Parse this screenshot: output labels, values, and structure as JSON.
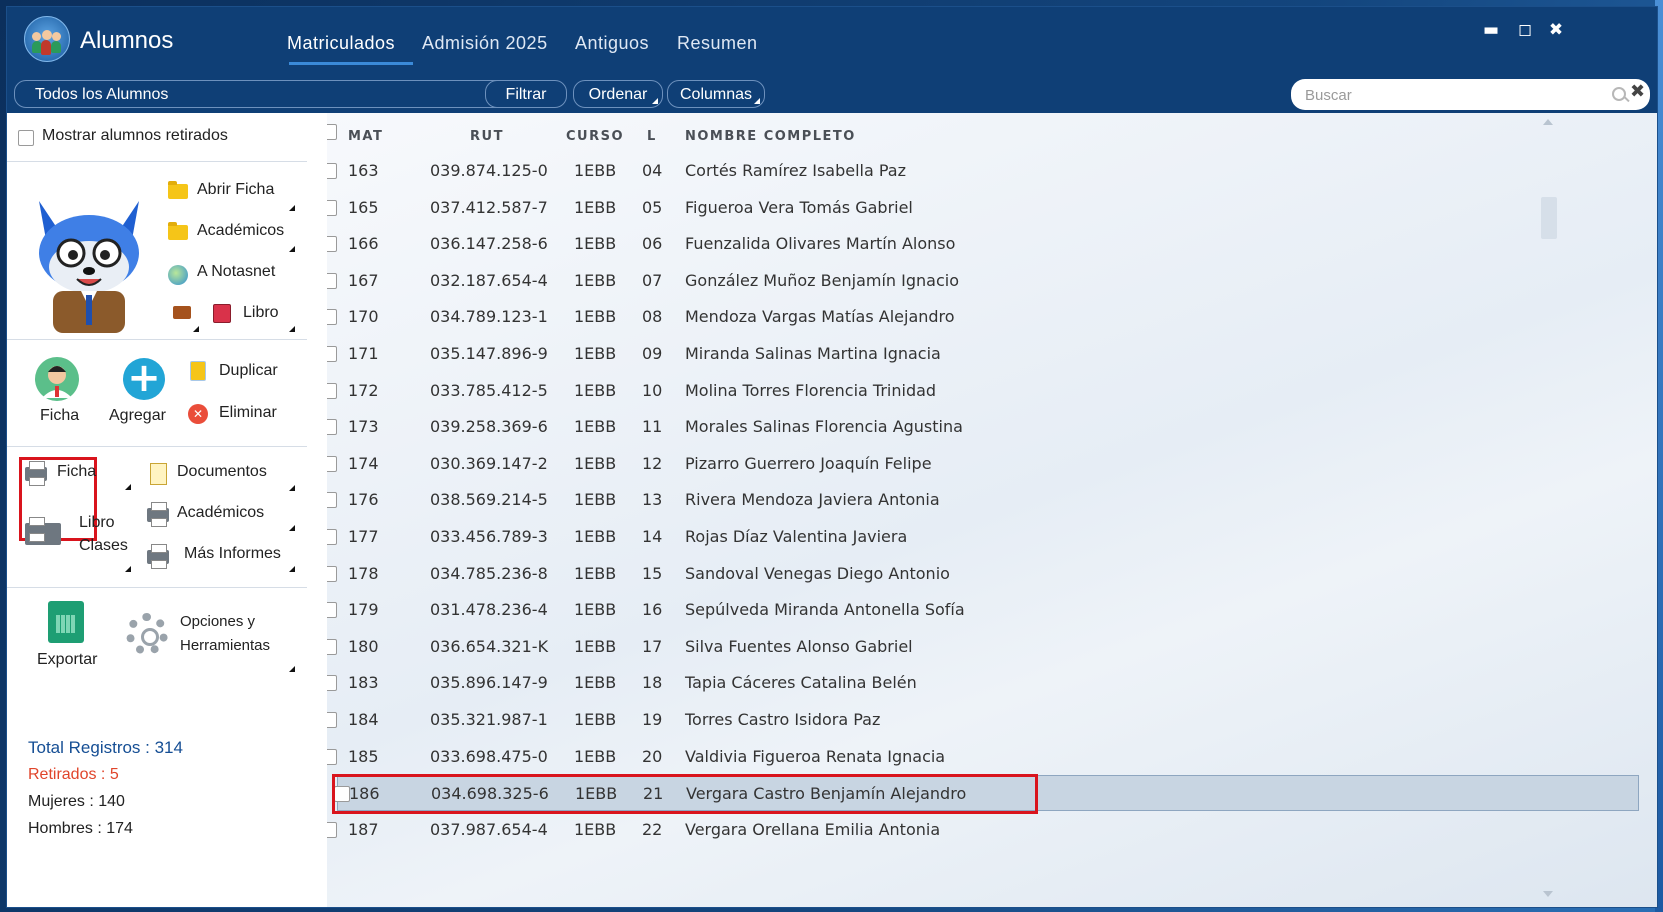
{
  "app": {
    "title": "Alumnos",
    "tabs": [
      "Matriculados",
      "Admisión 2025",
      "Antiguos",
      "Resumen"
    ],
    "active_tab": "Matriculados",
    "window_controls": {
      "minimize": "▬",
      "maximize": "◻",
      "close": "✖"
    }
  },
  "toolbar": {
    "filter_value": "Todos los Alumnos",
    "filter_button": "Filtrar",
    "sort_button": "Ordenar",
    "columns_button": "Columnas",
    "search_placeholder": "Buscar"
  },
  "sidebar": {
    "show_retired_label": "Mostrar alumnos retirados",
    "quick_actions": {
      "open_file": "Abrir Ficha",
      "academics": "Académicos",
      "notasnet": "A Notasnet",
      "book": "Libro"
    },
    "main_actions": {
      "ficha": "Ficha",
      "add": "Agregar",
      "duplicate": "Duplicar",
      "delete": "Eliminar"
    },
    "print": {
      "ficha": "Ficha",
      "documents": "Documentos",
      "academics": "Académicos",
      "class_book_1": "Libro",
      "class_book_2": "Clases",
      "more_reports": "Más Informes"
    },
    "export": "Exportar",
    "options_1": "Opciones y",
    "options_2": "Herramientas",
    "stats": {
      "total": "Total Registros : 314",
      "retired": "Retirados : 5",
      "women": "Mujeres : 140",
      "men": "Hombres : 174"
    }
  },
  "table": {
    "headers": {
      "mat": "MAT",
      "rut": "RUT",
      "curso": "CURSO",
      "l": "L",
      "nombre": "NOMBRE COMPLETO"
    },
    "rows": [
      {
        "mat": "163",
        "rut": "039.874.125-0",
        "curso": "1EBB",
        "l": "04",
        "nombre": "Cortés Ramírez Isabella Paz"
      },
      {
        "mat": "165",
        "rut": "037.412.587-7",
        "curso": "1EBB",
        "l": "05",
        "nombre": "Figueroa Vera Tomás Gabriel"
      },
      {
        "mat": "166",
        "rut": "036.147.258-6",
        "curso": "1EBB",
        "l": "06",
        "nombre": "Fuenzalida Olivares Martín Alonso"
      },
      {
        "mat": "167",
        "rut": "032.187.654-4",
        "curso": "1EBB",
        "l": "07",
        "nombre": "González Muñoz Benjamín Ignacio"
      },
      {
        "mat": "170",
        "rut": "034.789.123-1",
        "curso": "1EBB",
        "l": "08",
        "nombre": "Mendoza Vargas Matías Alejandro"
      },
      {
        "mat": "171",
        "rut": "035.147.896-9",
        "curso": "1EBB",
        "l": "09",
        "nombre": "Miranda Salinas Martina Ignacia"
      },
      {
        "mat": "172",
        "rut": "033.785.412-5",
        "curso": "1EBB",
        "l": "10",
        "nombre": "Molina Torres Florencia Trinidad"
      },
      {
        "mat": "173",
        "rut": "039.258.369-6",
        "curso": "1EBB",
        "l": "11",
        "nombre": "Morales Salinas Florencia Agustina"
      },
      {
        "mat": "174",
        "rut": "030.369.147-2",
        "curso": "1EBB",
        "l": "12",
        "nombre": "Pizarro Guerrero Joaquín Felipe"
      },
      {
        "mat": "176",
        "rut": "038.569.214-5",
        "curso": "1EBB",
        "l": "13",
        "nombre": "Rivera Mendoza Javiera Antonia"
      },
      {
        "mat": "177",
        "rut": "033.456.789-3",
        "curso": "1EBB",
        "l": "14",
        "nombre": "Rojas Díaz Valentina Javiera"
      },
      {
        "mat": "178",
        "rut": "034.785.236-8",
        "curso": "1EBB",
        "l": "15",
        "nombre": "Sandoval Venegas Diego Antonio"
      },
      {
        "mat": "179",
        "rut": "031.478.236-4",
        "curso": "1EBB",
        "l": "16",
        "nombre": "Sepúlveda Miranda Antonella Sofía"
      },
      {
        "mat": "180",
        "rut": "036.654.321-K",
        "curso": "1EBB",
        "l": "17",
        "nombre": "Silva Fuentes Alonso Gabriel"
      },
      {
        "mat": "183",
        "rut": "035.896.147-9",
        "curso": "1EBB",
        "l": "18",
        "nombre": "Tapia Cáceres Catalina Belén"
      },
      {
        "mat": "184",
        "rut": "035.321.987-1",
        "curso": "1EBB",
        "l": "19",
        "nombre": "Torres Castro Isidora Paz"
      },
      {
        "mat": "185",
        "rut": "033.698.475-0",
        "curso": "1EBB",
        "l": "20",
        "nombre": "Valdivia Figueroa Renata Ignacia"
      },
      {
        "mat": "186",
        "rut": "034.698.325-6",
        "curso": "1EBB",
        "l": "21",
        "nombre": "Vergara Castro Benjamín Alejandro"
      },
      {
        "mat": "187",
        "rut": "037.987.654-4",
        "curso": "1EBB",
        "l": "22",
        "nombre": "Vergara Orellana Emilia Antonia"
      }
    ],
    "selected_mat": "186"
  },
  "colors": {
    "header_bg": "#0f3f76",
    "accent": "#3b8ad8",
    "retired_text": "#e0452b",
    "highlight": "#d9141d"
  }
}
